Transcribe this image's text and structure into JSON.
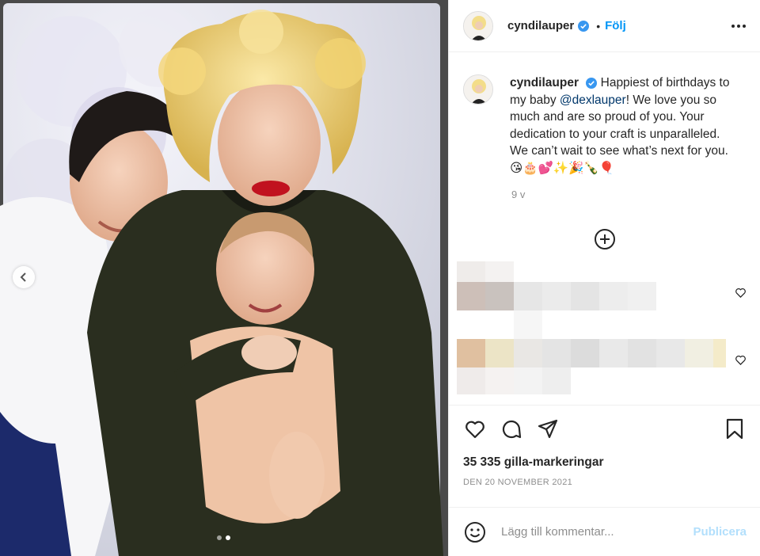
{
  "post": {
    "username": "cyndilauper",
    "follow_label": "Följ",
    "header_separator": "•",
    "caption": {
      "username": "cyndilauper",
      "text_before": "Happiest of birthdays to my baby ",
      "mention": "@dexlauper",
      "text_after": "! We love you so much and are so proud of you. Your dedication to your craft is unparalleled. We can’t wait to see what’s next for you. 😘🎂💕✨🎉🍾🎈"
    },
    "time_ago": "9 v",
    "likes": "35 335 gilla-markeringar",
    "date": "DEN 20 NOVEMBER 2021",
    "comment_placeholder": "Lägg till kommentar...",
    "publish_label": "Publicera"
  },
  "carousel": {
    "slides": 2,
    "active_index": 1
  },
  "colors": {
    "accent": "#0095f6",
    "mention": "#00376b",
    "muted": "#8e8e8e",
    "publish_disabled": "#b2dffc"
  },
  "icons": [
    "verified-badge",
    "more-options-icon",
    "add-comments-icon",
    "heart-icon",
    "comment-icon",
    "share-icon",
    "bookmark-icon",
    "emoji-icon",
    "chevron-left-icon"
  ]
}
